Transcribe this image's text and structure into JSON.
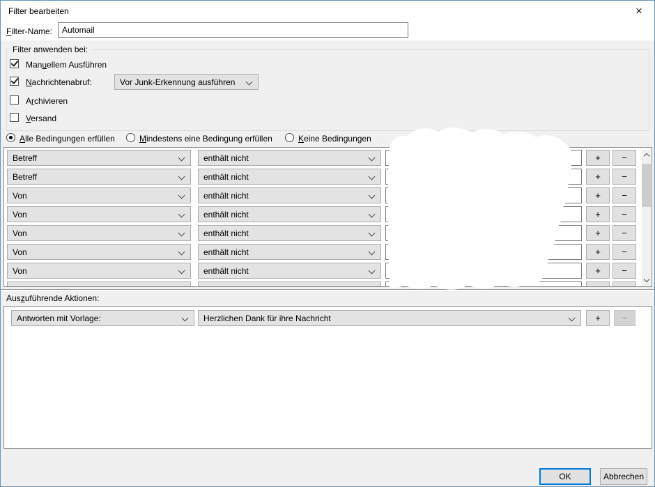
{
  "window": {
    "title": "Filter bearbeiten",
    "close_icon": "×"
  },
  "colors": {
    "accent": "#0078d7",
    "dialog_bg": "#f0f0f0",
    "titlebar_bg": "#ffffff",
    "control_bg": "#e3e3e3",
    "window_border": "#6496be"
  },
  "filter_name": {
    "label": "_F_ilter-Name:",
    "value": "Automail"
  },
  "apply_group": {
    "legend": "Filter anwenden bei:",
    "checkboxes": [
      {
        "label": "Man_u_ellem Ausführen",
        "checked": true
      },
      {
        "label": "_N_achrichtenabruf:",
        "checked": true,
        "dropdown": "Vor Junk-Erkennung ausführen"
      },
      {
        "label": "A_r_chivieren",
        "checked": false
      },
      {
        "label": "_V_ersand",
        "checked": false
      }
    ]
  },
  "match_options": [
    {
      "label": "_A_lle Bedingungen erfüllen",
      "selected": true
    },
    {
      "label": "_M_indestens eine Bedingung erfüllen",
      "selected": false
    },
    {
      "label": "_K_eine Bedingungen",
      "selected": false
    }
  ],
  "conditions": {
    "add_label": "+",
    "remove_label": "−",
    "rows": [
      {
        "attribute": "Betreff",
        "operator": "enthält nicht",
        "value": ""
      },
      {
        "attribute": "Betreff",
        "operator": "enthält nicht",
        "value": ""
      },
      {
        "attribute": "Von",
        "operator": "enthält nicht",
        "value": ""
      },
      {
        "attribute": "Von",
        "operator": "enthält nicht",
        "value": ""
      },
      {
        "attribute": "Von",
        "operator": "enthält nicht",
        "value": ""
      },
      {
        "attribute": "Von",
        "operator": "enthält nicht",
        "value": ""
      },
      {
        "attribute": "Von",
        "operator": "enthält nicht",
        "value": ""
      },
      {
        "attribute": "",
        "operator": "",
        "value": "",
        "partial": true
      }
    ]
  },
  "actions": {
    "label": "Aus_z_uführende Aktionen:",
    "add_label": "+",
    "remove_label": "−",
    "rows": [
      {
        "action": "Antworten mit Vorlage:",
        "value": "Herzlichen Dank für ihre Nachricht",
        "remove_disabled": true
      }
    ]
  },
  "footer": {
    "ok_label": "OK",
    "cancel_label": "Abbrechen"
  }
}
